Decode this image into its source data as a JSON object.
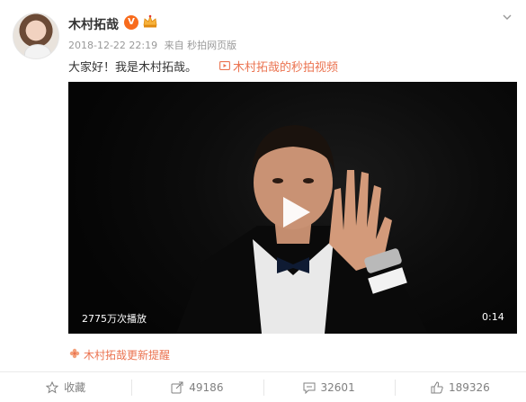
{
  "user": {
    "name": "木村拓哉",
    "verified_badge": "V",
    "avatar_icon": "avatar"
  },
  "meta": {
    "timestamp": "2018-12-22 22:19",
    "source": "来自 秒拍网页版"
  },
  "post": {
    "text": "大家好！我是木村拓哉。",
    "video_link": "木村拓哉的秒拍视频"
  },
  "video": {
    "play_count": "2775万次播放",
    "duration": "0:14"
  },
  "update_link": "木村拓哉更新提醒",
  "actions": {
    "favorite": "收藏",
    "repost": "49186",
    "comment": "32601",
    "like": "189326"
  },
  "colors": {
    "accent": "#eb7350",
    "badge": "#f86b1c",
    "muted": "#808080"
  }
}
